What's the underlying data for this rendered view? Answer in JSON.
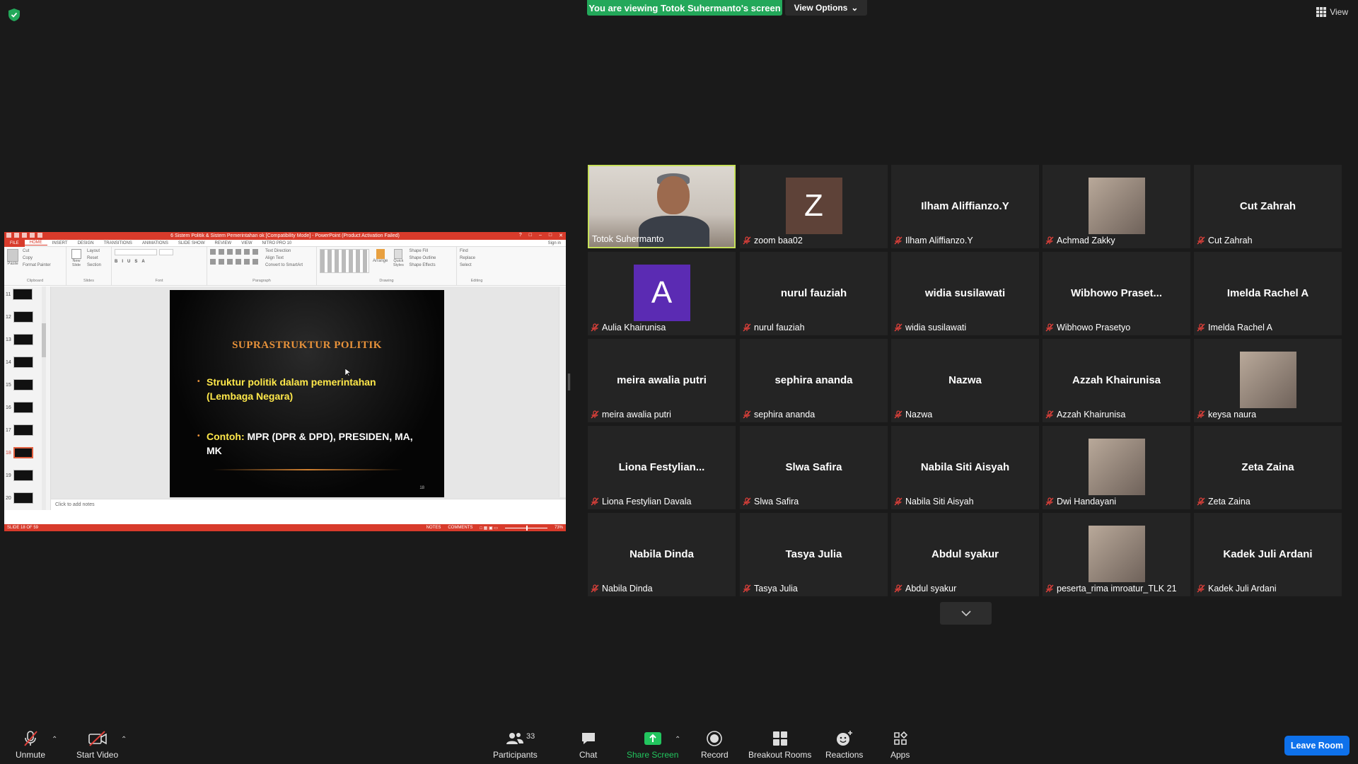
{
  "banner": {
    "viewing_text": "You are viewing Totok Suhermanto's screen",
    "view_options": "View Options"
  },
  "top_right": {
    "view_label": "View"
  },
  "share": {
    "ppt_title": "6 Sistem Politik & Sistem Pemerintahan ok [Compatibility Mode] - PowerPoint (Product Activation Failed)",
    "tabs": [
      "FILE",
      "HOME",
      "INSERT",
      "DESIGN",
      "TRANSITIONS",
      "ANIMATIONS",
      "SLIDE SHOW",
      "REVIEW",
      "VIEW",
      "NITRO PRO 10"
    ],
    "sign_in": "Sign in",
    "ribbon": {
      "clipboard": {
        "paste": "Paste",
        "cut": "Cut",
        "copy": "Copy",
        "format_painter": "Format Painter",
        "label": "Clipboard"
      },
      "slides": {
        "new_slide": "New Slide",
        "layout": "Layout",
        "reset": "Reset",
        "section": "Section",
        "label": "Slides"
      },
      "font": {
        "label": "Font"
      },
      "paragraph": {
        "text_direction": "Text Direction",
        "align_text": "Align Text",
        "convert": "Convert to SmartArt",
        "label": "Paragraph"
      },
      "drawing": {
        "arrange": "Arrange",
        "quick_styles": "Quick Styles",
        "shape_fill": "Shape Fill",
        "shape_outline": "Shape Outline",
        "shape_effects": "Shape Effects",
        "label": "Drawing"
      },
      "editing": {
        "find": "Find",
        "replace": "Replace",
        "select": "Select",
        "label": "Editing"
      }
    },
    "thumbs": [
      "11",
      "12",
      "13",
      "14",
      "15",
      "16",
      "17",
      "18",
      "19",
      "20"
    ],
    "active_thumb": "18",
    "slide": {
      "title": "SUPRASTRUKTUR POLITIK",
      "bullet1": "Struktur politik dalam pemerintahan (Lembaga Negara)",
      "bullet2_prefix": "Contoh:",
      "bullet2_rest": " MPR (DPR & DPD), PRESIDEN, MA, MK",
      "number": "18"
    },
    "notes_placeholder": "Click to add notes",
    "status": {
      "slide_of": "SLIDE 18 OF 59",
      "notes": "NOTES",
      "comments": "COMMENTS",
      "zoom": "73%"
    }
  },
  "participants": [
    {
      "name": "Totok Suhermanto",
      "center": "",
      "type": "video",
      "muted": false
    },
    {
      "name": "zoom baa02",
      "center": "",
      "type": "avatar-z",
      "initial": "Z",
      "muted": true
    },
    {
      "name": "Ilham Aliffianzo.Y",
      "center": "Ilham Aliffianzo.Y",
      "type": "name",
      "muted": true
    },
    {
      "name": "Achmad Zakky",
      "center": "",
      "type": "avatar-img",
      "muted": true
    },
    {
      "name": "Cut Zahrah",
      "center": "Cut Zahrah",
      "type": "name",
      "muted": true
    },
    {
      "name": "Aulia Khairunisa",
      "center": "",
      "type": "avatar-a",
      "initial": "A",
      "muted": true
    },
    {
      "name": "nurul fauziah",
      "center": "nurul fauziah",
      "type": "name",
      "muted": true
    },
    {
      "name": "widia susilawati",
      "center": "widia susilawati",
      "type": "name",
      "muted": true
    },
    {
      "name": "Wibhowo Prasetyo",
      "center": "Wibhowo  Praset...",
      "type": "name",
      "muted": true
    },
    {
      "name": "Imelda Rachel A",
      "center": "Imelda Rachel A",
      "type": "name",
      "muted": true
    },
    {
      "name": "meira awalia putri",
      "center": "meira awalia putri",
      "type": "name",
      "muted": true
    },
    {
      "name": "sephira ananda",
      "center": "sephira ananda",
      "type": "name",
      "muted": true
    },
    {
      "name": "Nazwa",
      "center": "Nazwa",
      "type": "name",
      "muted": true
    },
    {
      "name": "Azzah Khairunisa",
      "center": "Azzah Khairunisa",
      "type": "name",
      "muted": true
    },
    {
      "name": "keysa naura",
      "center": "",
      "type": "avatar-img",
      "muted": true
    },
    {
      "name": "Liona Festylian Davala",
      "center": "Liona  Festylian...",
      "type": "name",
      "muted": true
    },
    {
      "name": "Slwa Safira",
      "center": "Slwa Safira",
      "type": "name",
      "muted": true
    },
    {
      "name": "Nabila Siti Aisyah",
      "center": "Nabila Siti Aisyah",
      "type": "name",
      "muted": true
    },
    {
      "name": "Dwi Handayani",
      "center": "",
      "type": "avatar-img",
      "muted": true
    },
    {
      "name": "Zeta Zaina",
      "center": "Zeta Zaina",
      "type": "name",
      "muted": true
    },
    {
      "name": "Nabila Dinda",
      "center": "Nabila Dinda",
      "type": "name",
      "muted": true
    },
    {
      "name": "Tasya Julia",
      "center": "Tasya Julia",
      "type": "name",
      "muted": true
    },
    {
      "name": "Abdul syakur",
      "center": "Abdul syakur",
      "type": "name",
      "muted": true
    },
    {
      "name": "peserta_rima imroatur_TLK 21",
      "center": "",
      "type": "avatar-img",
      "muted": true
    },
    {
      "name": "Kadek Juli Ardani",
      "center": "Kadek Juli Ardani",
      "type": "name",
      "muted": true
    }
  ],
  "toolbar": {
    "unmute": "Unmute",
    "start_video": "Start Video",
    "participants": "Participants",
    "participants_count": "33",
    "chat": "Chat",
    "share_screen": "Share Screen",
    "record": "Record",
    "breakout_rooms": "Breakout Rooms",
    "reactions": "Reactions",
    "apps": "Apps",
    "leave": "Leave Room"
  },
  "colors": {
    "banner_green": "#23a85a",
    "leave_blue": "#0e71eb",
    "active_border": "#c6e05a",
    "share_green": "#22c55e",
    "muted_red": "#e0403a"
  }
}
